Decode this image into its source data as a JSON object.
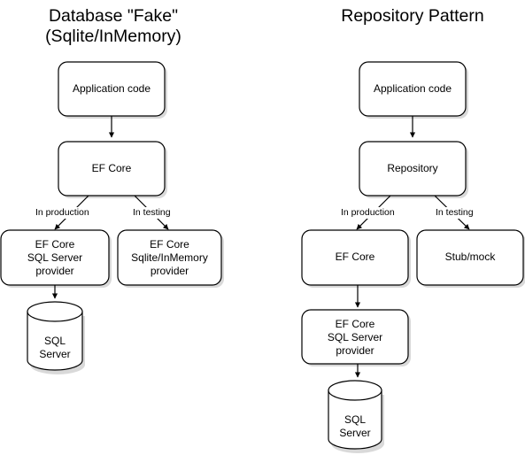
{
  "diagram": {
    "title_left": "Database \"Fake\"\n(Sqlite/InMemory)",
    "title_right": "Repository Pattern",
    "styles": {
      "node_stroke": "#000000",
      "node_fill": "#ffffff",
      "shadow": "#d9d9d9",
      "text": "#000000",
      "background": "#ffffff"
    },
    "columns": [
      {
        "name": "database-fake",
        "title": "Database \"Fake\"\n(Sqlite/InMemory)",
        "nodes": [
          {
            "id": "app-code",
            "label": "Application code",
            "shape": "rounded-rect"
          },
          {
            "id": "ef-core",
            "label": "EF Core",
            "shape": "rounded-rect"
          },
          {
            "id": "sqlserver-prov",
            "label": "EF Core\nSQL Server\nprovider",
            "shape": "rounded-rect"
          },
          {
            "id": "sqlite-prov",
            "label": "EF Core\nSqlite/InMemory\nprovider",
            "shape": "rounded-rect"
          },
          {
            "id": "sql-server-db",
            "label": "SQL\nServer",
            "shape": "cylinder"
          }
        ],
        "edges": [
          {
            "from": "app-code",
            "to": "ef-core",
            "label": ""
          },
          {
            "from": "ef-core",
            "to": "sqlserver-prov",
            "label": "In production"
          },
          {
            "from": "ef-core",
            "to": "sqlite-prov",
            "label": "In testing"
          },
          {
            "from": "sqlserver-prov",
            "to": "sql-server-db",
            "label": ""
          }
        ]
      },
      {
        "name": "repository-pattern",
        "title": "Repository Pattern",
        "nodes": [
          {
            "id": "app-code-2",
            "label": "Application code",
            "shape": "rounded-rect"
          },
          {
            "id": "repository",
            "label": "Repository",
            "shape": "rounded-rect"
          },
          {
            "id": "ef-core-2",
            "label": "EF Core",
            "shape": "rounded-rect"
          },
          {
            "id": "stub-mock",
            "label": "Stub/mock",
            "shape": "rounded-rect"
          },
          {
            "id": "sqlserver-prov-2",
            "label": "EF Core\nSQL Server\nprovider",
            "shape": "rounded-rect"
          },
          {
            "id": "sql-server-db-2",
            "label": "SQL\nServer",
            "shape": "cylinder"
          }
        ],
        "edges": [
          {
            "from": "app-code-2",
            "to": "repository",
            "label": ""
          },
          {
            "from": "repository",
            "to": "ef-core-2",
            "label": "In production"
          },
          {
            "from": "repository",
            "to": "stub-mock",
            "label": "In testing"
          },
          {
            "from": "ef-core-2",
            "to": "sqlserver-prov-2",
            "label": ""
          },
          {
            "from": "sqlserver-prov-2",
            "to": "sql-server-db-2",
            "label": ""
          }
        ]
      }
    ],
    "labels": {
      "left_in_production": "In production",
      "left_in_testing": "In testing",
      "right_in_production": "In production",
      "right_in_testing": "In testing"
    }
  }
}
